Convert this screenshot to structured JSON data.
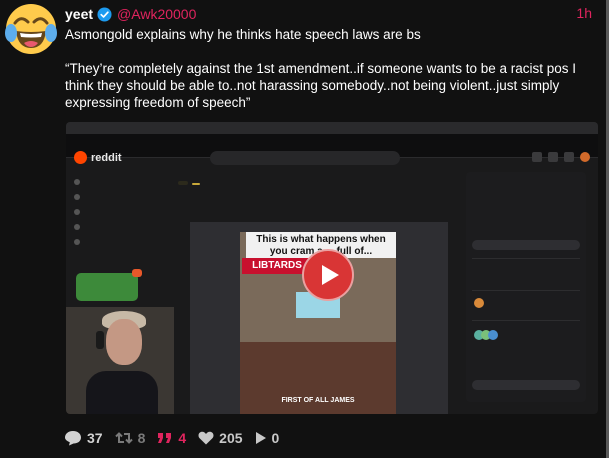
{
  "post": {
    "author": "yeet",
    "handle": "@Awk20000",
    "time": "1h",
    "text_line1": "Asmongold explains why he thinks hate speech laws are bs",
    "text_quote": "“They’re completely against the 1st amendment..if someone wants to be a racist pos I think they should be able to..not harassing somebody..not being violent..just simply expressing freedom of speech”"
  },
  "media": {
    "reddit_logo": "reddit",
    "video_banner": "This is what happens when you cram a ... full of...",
    "video_tag": "LIBTARDS",
    "video_caption": "FIRST OF ALL JAMES"
  },
  "actions": {
    "replies": "37",
    "reposts": "8",
    "quotes": "4",
    "likes": "205",
    "views": "0"
  },
  "colors": {
    "accent": "#e0245e",
    "verified": "#1d9bf0",
    "play_button": "#d93535"
  }
}
